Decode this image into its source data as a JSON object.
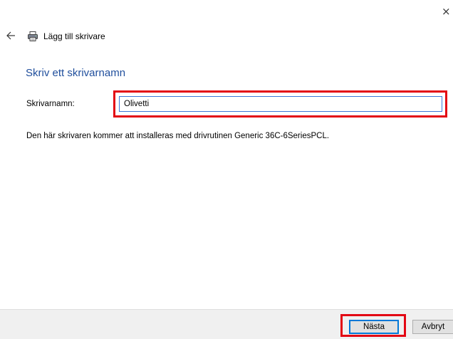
{
  "window": {
    "close_glyph": "×",
    "close_icon": "close-icon"
  },
  "header": {
    "back_icon": "back-arrow-icon",
    "printer_icon": "printer-icon",
    "title": "Lägg till skrivare"
  },
  "main": {
    "heading": "Skriv ett skrivarnamn",
    "printer_name_label": "Skrivarnamn:",
    "printer_name_value": "Olivetti",
    "driver_info": "Den här skrivaren kommer att installeras med drivrutinen Generic 36C-6SeriesPCL."
  },
  "footer": {
    "next_label": "Nästa",
    "cancel_label": "Avbryt"
  },
  "colors": {
    "heading": "#1f4e9c",
    "highlight": "#e30613",
    "input_focus_border": "#3c78d8",
    "footer_background": "#f0f0f0",
    "default_button_border": "#0078d7"
  }
}
